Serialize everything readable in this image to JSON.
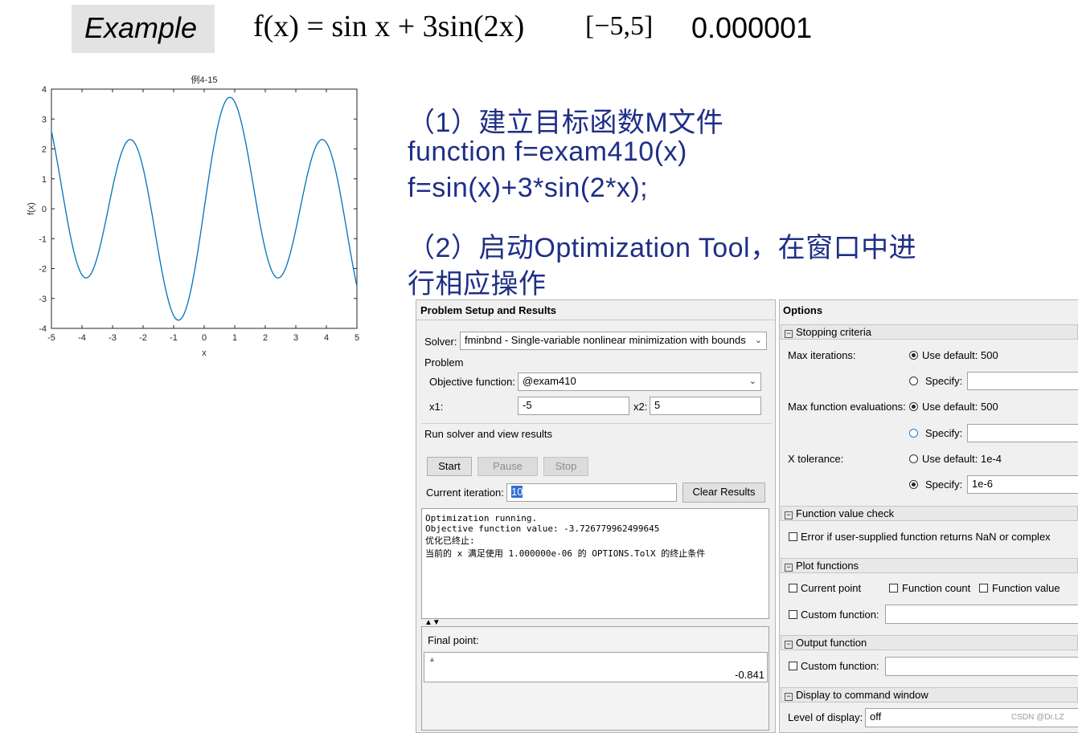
{
  "header": {
    "example_label": "Example",
    "formula": "f(x) = sin x + 3sin(2x)",
    "interval": "[−5,5]",
    "tolerance": "0.000001"
  },
  "slide_text": {
    "step1": "（1）建立目标函数M文件",
    "code_line1": "function f=exam410(x)",
    "code_line2": "f=sin(x)+3*sin(2*x);",
    "step2_line1": "（2）启动Optimization Tool，在窗口中进",
    "step2_line2": "行相应操作"
  },
  "chart_data": {
    "type": "line",
    "title": "例4-15",
    "xlabel": "x",
    "ylabel": "f(x)",
    "xlim": [
      -5,
      5
    ],
    "ylim": [
      -4,
      4
    ],
    "xticks": [
      "-5",
      "-4",
      "-3",
      "-2",
      "-1",
      "0",
      "1",
      "2",
      "3",
      "4",
      "5"
    ],
    "yticks": [
      "4",
      "3",
      "2",
      "1",
      "0",
      "-1",
      "-2",
      "-3",
      "-4"
    ],
    "function": "sin(x)+3*sin(2*x)",
    "series": [
      {
        "color": "#0072bd",
        "x": [
          -5,
          -4.5,
          -4,
          -3.5,
          -3,
          -2.5,
          -2,
          -1.5,
          -1,
          -0.5,
          0,
          0.5,
          1,
          1.5,
          2,
          2.5,
          3,
          3.5,
          4,
          4.5,
          5
        ],
        "y": [
          2.59,
          -0.23,
          -2.22,
          2.31,
          -1.04,
          -2.24,
          1.36,
          -1.42,
          -3.57,
          -3.0,
          0.0,
          3.0,
          3.57,
          1.42,
          -1.36,
          2.24,
          1.04,
          -2.31,
          2.22,
          0.23,
          -2.59
        ]
      }
    ]
  },
  "gui": {
    "left_panel_title": "Problem Setup and Results",
    "solver_label": "Solver:",
    "solver_value": "fminbnd - Single-variable nonlinear minimization with bounds",
    "problem_label": "Problem",
    "objective_label": "Objective function:",
    "objective_value": "@exam410",
    "x1_label": "x1:",
    "x1_value": "-5",
    "x2_label": "x2:",
    "x2_value": "5",
    "run_label": "Run solver and view results",
    "start": "Start",
    "pause": "Pause",
    "stop": "Stop",
    "iteration_label": "Current iteration:",
    "iteration_value": "10",
    "clear_results": "Clear Results",
    "output_lines": [
      "Optimization running.",
      "Objective function value: -3.726779962499645",
      "优化已终止:",
      " 当前的 x 满足使用 1.000000e-06 的 OPTIONS.TolX 的终止条件"
    ],
    "final_point_label": "Final point:",
    "final_point_value": "-0.841",
    "right_panel_title": "Options",
    "stopping_criteria": "Stopping criteria",
    "max_iter_label": "Max iterations:",
    "use_default_500": "Use default: 500",
    "specify": "Specify:",
    "max_fev_label": "Max function evaluations:",
    "xtol_label": "X tolerance:",
    "use_default_1e4": "Use default: 1e-4",
    "xtol_value": "1e-6",
    "function_value_check": "Function value check",
    "nan_check": "Error if user-supplied function returns NaN or complex",
    "plot_functions": "Plot functions",
    "current_point": "Current point",
    "function_count": "Function count",
    "function_value": "Function value",
    "custom_function": "Custom function:",
    "output_function": "Output function",
    "display_cmd": "Display to command window",
    "level_label": "Level of display:",
    "level_value": "off"
  },
  "watermark": "CSDN @Dr.LZ"
}
